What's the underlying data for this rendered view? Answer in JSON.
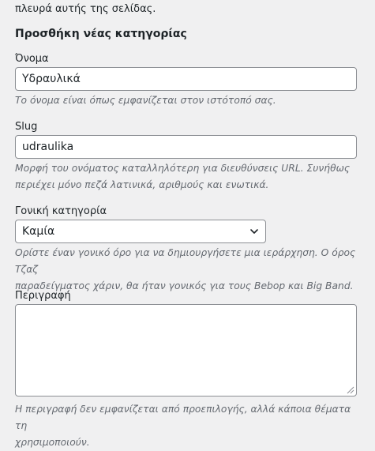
{
  "top_note": "πλευρά αυτής της σελίδας.",
  "add_category_title": "Προσθήκη νέας κατηγορίας",
  "name_field": {
    "label": "Όνομα",
    "value": "Υδραυλικά",
    "help": "Το όνομα είναι όπως εμφανίζεται στον ιστότοπό σας."
  },
  "slug_field": {
    "label": "Slug",
    "value": "udraulika",
    "help_line1": "Μορφή του ονόματος καταλληλότερη για διευθύνσεις URL. Συνήθως",
    "help_line2": "περιέχει μόνο πεζά λατινικά, αριθμούς και ενωτικά."
  },
  "parent_field": {
    "label": "Γονική κατηγορία",
    "selected": "Καμία",
    "help_line1": "Ορίστε έναν γονικό όρο για να δημιουργήσετε μια ιεράρχηση. Ο όρος Τζαζ",
    "help_line2": "παραδείγματος χάριν, θα ήταν γονικός για τους Bebop και Big Band."
  },
  "description_field": {
    "label": "Περιγραφή",
    "value": "",
    "help_line1": "Η περιγραφή δεν εμφανίζεται από προεπιλογής, αλλά κάποια θέματα τη",
    "help_line2": "χρησιμοποιούν."
  },
  "icons": {
    "select_arrow": "chevron-down-icon",
    "textarea_resize": "resize-grip-icon"
  },
  "colors": {
    "background": "#f0f0f1",
    "text": "#1d2327",
    "help_text": "#646970",
    "input_border": "#8c8f94"
  }
}
